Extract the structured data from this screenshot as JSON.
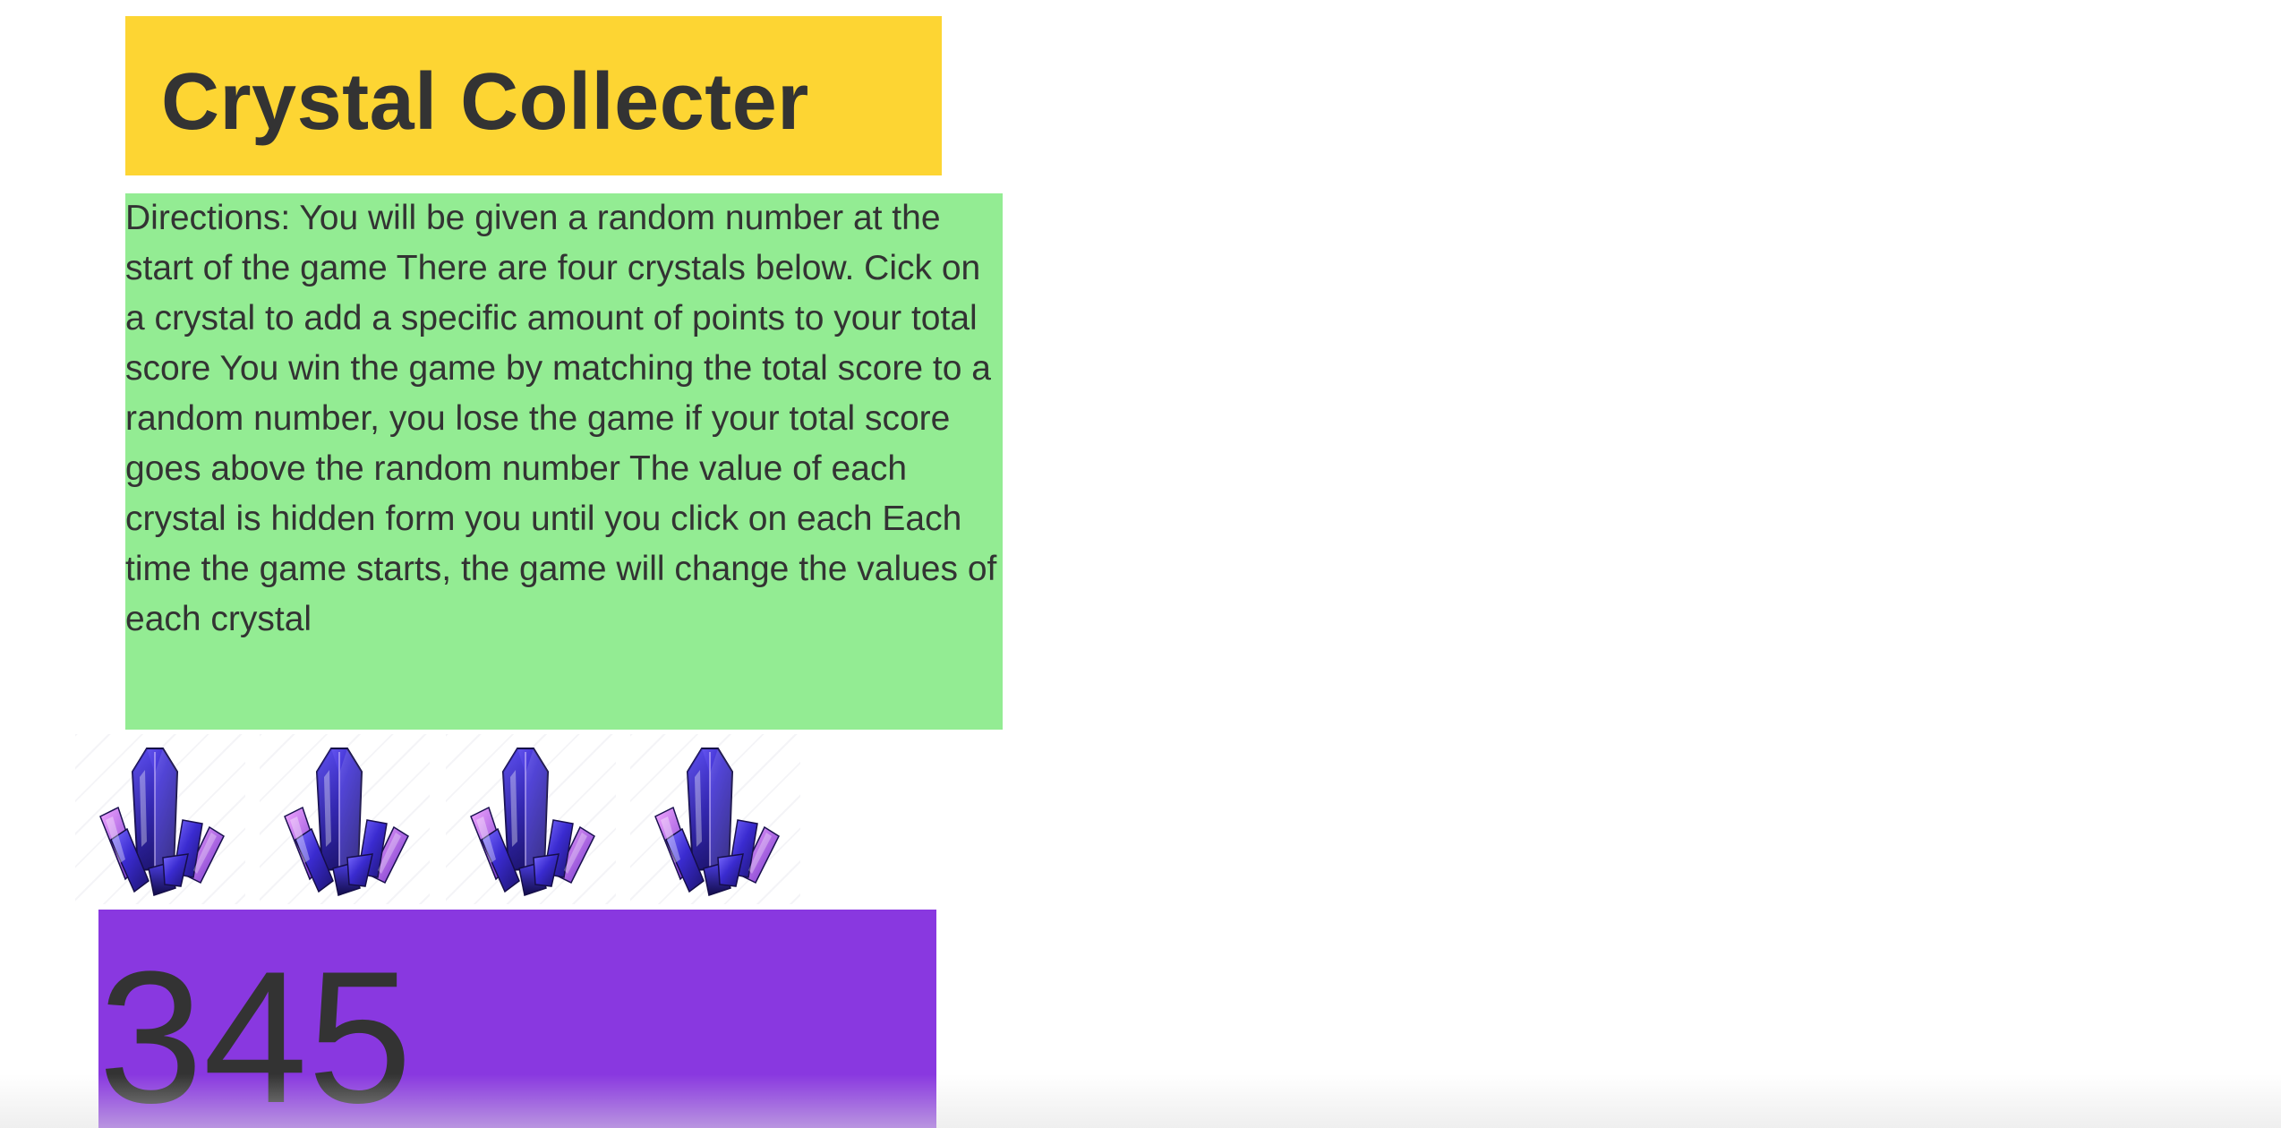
{
  "game": {
    "title": "Crystal Collecter",
    "directions": "Directions: You will be given a random number at the start of the game There are four crystals below. Cick on a crystal to add a specific amount of points to your total score You win the game by matching the total score to a random number, you lose the game if your total score goes above the random number The value of each crystal is hidden form you until you click on each Each time the game starts, the game will change the values of each crystal",
    "score": "345"
  },
  "crystals": [
    {
      "icon": "crystal-icon"
    },
    {
      "icon": "crystal-icon"
    },
    {
      "icon": "crystal-icon"
    },
    {
      "icon": "crystal-icon"
    }
  ],
  "colors": {
    "title_bg": "#fdd533",
    "directions_bg": "#93ec93",
    "score_bg": "#8938e0",
    "text": "#333333"
  }
}
